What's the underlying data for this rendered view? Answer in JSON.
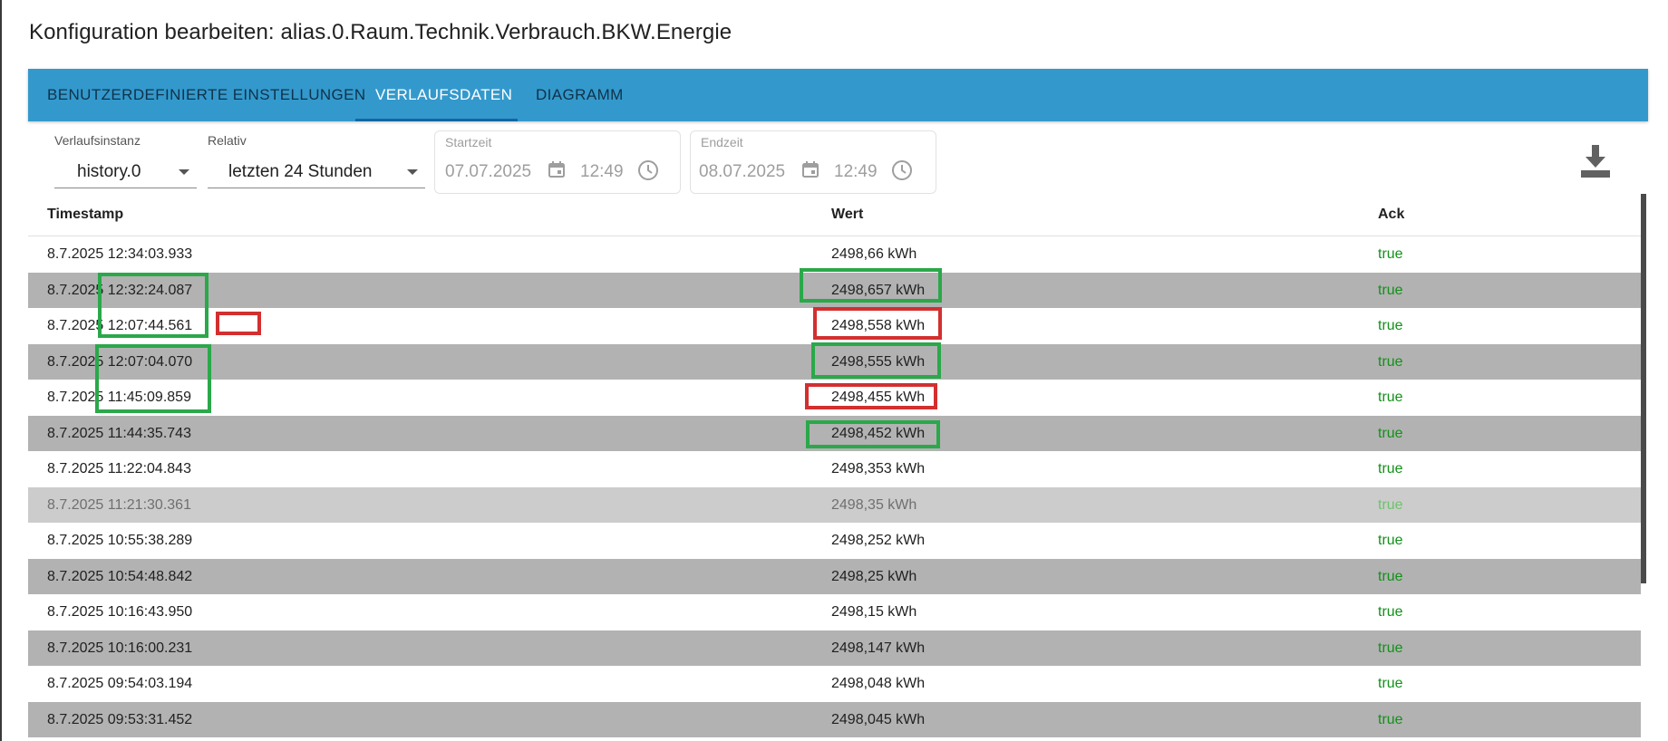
{
  "dialog": {
    "title": "Konfiguration bearbeiten: alias.0.Raum.Technik.Verbrauch.BKW.Energie"
  },
  "tabs": [
    {
      "label": "BENUTZERDEFINIERTE EINSTELLUNGEN",
      "active": false
    },
    {
      "label": "VERLAUFSDATEN",
      "active": true
    },
    {
      "label": "DIAGRAMM",
      "active": false
    }
  ],
  "controls": {
    "instance": {
      "label": "Verlaufsinstanz",
      "value": "history.0"
    },
    "relative": {
      "label": "Relativ",
      "value": "letzten 24 Stunden"
    },
    "start": {
      "label": "Startzeit",
      "date": "07.07.2025",
      "time": "12:49"
    },
    "end": {
      "label": "Endzeit",
      "date": "08.07.2025",
      "time": "12:49"
    },
    "download_icon": "download-icon"
  },
  "table": {
    "columns": [
      "Timestamp",
      "Wert",
      "Ack"
    ],
    "rows": [
      {
        "ts": "8.7.2025 12:34:03.933",
        "val": "2498,66 kWh",
        "ack": "true"
      },
      {
        "ts": "8.7.2025 12:32:24.087",
        "val": "2498,657 kWh",
        "ack": "true"
      },
      {
        "ts": "8.7.2025 12:07:44.561",
        "val": "2498,558 kWh",
        "ack": "true"
      },
      {
        "ts": "8.7.2025 12:07:04.070",
        "val": "2498,555 kWh",
        "ack": "true"
      },
      {
        "ts": "8.7.2025 11:45:09.859",
        "val": "2498,455 kWh",
        "ack": "true"
      },
      {
        "ts": "8.7.2025 11:44:35.743",
        "val": "2498,452 kWh",
        "ack": "true"
      },
      {
        "ts": "8.7.2025 11:22:04.843",
        "val": "2498,353 kWh",
        "ack": "true"
      },
      {
        "ts": "8.7.2025 11:21:30.361",
        "val": "2498,35 kWh",
        "ack": "true"
      },
      {
        "ts": "8.7.2025 10:55:38.289",
        "val": "2498,252 kWh",
        "ack": "true"
      },
      {
        "ts": "8.7.2025 10:54:48.842",
        "val": "2498,25 kWh",
        "ack": "true"
      },
      {
        "ts": "8.7.2025 10:16:43.950",
        "val": "2498,15 kWh",
        "ack": "true"
      },
      {
        "ts": "8.7.2025 10:16:00.231",
        "val": "2498,147 kWh",
        "ack": "true"
      },
      {
        "ts": "8.7.2025 09:54:03.194",
        "val": "2498,048 kWh",
        "ack": "true"
      },
      {
        "ts": "8.7.2025 09:53:31.452",
        "val": "2498,045 kWh",
        "ack": "true"
      }
    ]
  },
  "colors": {
    "tabbar": "#3399cc",
    "ack_true": "#13911a",
    "highlight_green": "#2aa84a",
    "highlight_red": "#d32f2f"
  }
}
